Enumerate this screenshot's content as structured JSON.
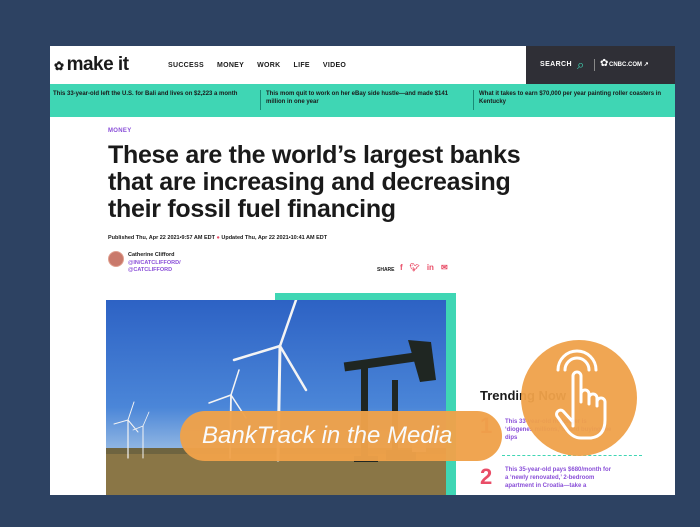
{
  "header": {
    "logo": "make it",
    "nav": [
      "SUCCESS",
      "MONEY",
      "WORK",
      "LIFE",
      "VIDEO"
    ],
    "search_label": "SEARCH",
    "partner": "CNBC.COM ↗"
  },
  "ticker": [
    "This 33-year-old left the U.S. for Bali and lives on $2,223 a month",
    "This mom quit to work on her eBay side hustle—and made $141 million in one year",
    "What it takes to earn $70,000 per year painting roller coasters in Kentucky"
  ],
  "article": {
    "section": "MONEY",
    "headline": "These are the world’s largest banks that are increasing and decreasing their fossil fuel financing",
    "published": "Published Thu, Apr 22 2021•9:57 AM EDT",
    "updated": "Updated Thu, Apr 22 2021•10:41 AM EDT",
    "author_name": "Catherine Clifford",
    "author_links": [
      "@IN/CATCLIFFORD/",
      "@CATCLIFFORD"
    ],
    "share_label": "SHARE"
  },
  "trending": {
    "title": "Trending Now",
    "items": [
      {
        "num": "1",
        "text": "This 33-year-old no longer is ‘diogenes millions,’ ... and buying the dips"
      },
      {
        "num": "2",
        "text": "This 35-year-old pays $680/month for a ‘newly renovated,’ 2-bedroom apartment in Croatia—take a"
      }
    ]
  },
  "overlay": {
    "banner_text": "BankTrack in the Media"
  },
  "colors": {
    "background": "#2d4262",
    "accent_green": "#3fd6b4",
    "accent_purple": "#8a4fd8",
    "accent_red": "#e94d67",
    "banner_orange": "#f0a24a"
  }
}
